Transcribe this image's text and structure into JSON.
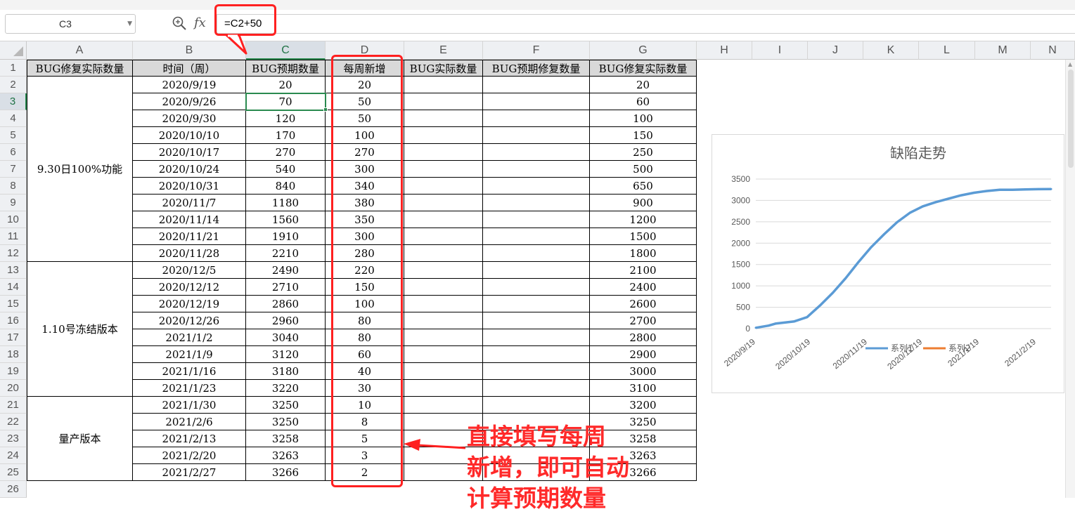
{
  "formula_bar": {
    "name_box": "C3",
    "formula": "=C2+50",
    "zoom_icon": "zoom-formula-icon",
    "fx_icon": "fx-function-icon"
  },
  "columns": [
    "A",
    "B",
    "C",
    "D",
    "E",
    "F",
    "G",
    "H",
    "I",
    "J",
    "K",
    "L",
    "M",
    "N"
  ],
  "row_numbers": [
    "1",
    "2",
    "3",
    "4",
    "5",
    "6",
    "7",
    "8",
    "9",
    "10",
    "11",
    "12",
    "13",
    "14",
    "15",
    "16",
    "17",
    "18",
    "19",
    "20",
    "21",
    "22",
    "23",
    "24",
    "25",
    "26"
  ],
  "selected_cell": {
    "column": "C",
    "row": "3"
  },
  "headers": [
    "BUG修复实际数量",
    "时间（周）",
    "BUG预期数量",
    "每周新增",
    "BUG实际数量",
    "BUG预期修复数量",
    "BUG修复实际数量"
  ],
  "groups": [
    "9.30日100%功能",
    "1.10号冻结版本",
    "量产版本"
  ],
  "rows": [
    {
      "date": "2020/9/19",
      "expected": "20",
      "weekly": "20",
      "fix_actual": "20"
    },
    {
      "date": "2020/9/26",
      "expected": "70",
      "weekly": "50",
      "fix_actual": "60"
    },
    {
      "date": "2020/9/30",
      "expected": "120",
      "weekly": "50",
      "fix_actual": "100"
    },
    {
      "date": "2020/10/10",
      "expected": "170",
      "weekly": "100",
      "fix_actual": "150"
    },
    {
      "date": "2020/10/17",
      "expected": "270",
      "weekly": "270",
      "fix_actual": "250"
    },
    {
      "date": "2020/10/24",
      "expected": "540",
      "weekly": "300",
      "fix_actual": "500"
    },
    {
      "date": "2020/10/31",
      "expected": "840",
      "weekly": "340",
      "fix_actual": "650"
    },
    {
      "date": "2020/11/7",
      "expected": "1180",
      "weekly": "380",
      "fix_actual": "900"
    },
    {
      "date": "2020/11/14",
      "expected": "1560",
      "weekly": "350",
      "fix_actual": "1200"
    },
    {
      "date": "2020/11/21",
      "expected": "1910",
      "weekly": "300",
      "fix_actual": "1500"
    },
    {
      "date": "2020/11/28",
      "expected": "2210",
      "weekly": "280",
      "fix_actual": "1800"
    },
    {
      "date": "2020/12/5",
      "expected": "2490",
      "weekly": "220",
      "fix_actual": "2100"
    },
    {
      "date": "2020/12/12",
      "expected": "2710",
      "weekly": "150",
      "fix_actual": "2400"
    },
    {
      "date": "2020/12/19",
      "expected": "2860",
      "weekly": "100",
      "fix_actual": "2600"
    },
    {
      "date": "2020/12/26",
      "expected": "2960",
      "weekly": "80",
      "fix_actual": "2700"
    },
    {
      "date": "2021/1/2",
      "expected": "3040",
      "weekly": "80",
      "fix_actual": "2800"
    },
    {
      "date": "2021/1/9",
      "expected": "3120",
      "weekly": "60",
      "fix_actual": "2900"
    },
    {
      "date": "2021/1/16",
      "expected": "3180",
      "weekly": "40",
      "fix_actual": "3000"
    },
    {
      "date": "2021/1/23",
      "expected": "3220",
      "weekly": "30",
      "fix_actual": "3100"
    },
    {
      "date": "2021/1/30",
      "expected": "3250",
      "weekly": "10",
      "fix_actual": "3200"
    },
    {
      "date": "2021/2/6",
      "expected": "3250",
      "weekly": "8",
      "fix_actual": "3250"
    },
    {
      "date": "2021/2/13",
      "expected": "3258",
      "weekly": "5",
      "fix_actual": "3258"
    },
    {
      "date": "2021/2/20",
      "expected": "3263",
      "weekly": "3",
      "fix_actual": "3263"
    },
    {
      "date": "2021/2/27",
      "expected": "3266",
      "weekly": "2",
      "fix_actual": "3266"
    }
  ],
  "annotation": [
    "直接填写每周",
    "新增，即可自动",
    "计算预期数量"
  ],
  "colors": {
    "accent_green": "#217346",
    "red": "#ff2020",
    "series1": "#5b9bd5",
    "series2": "#ed7d31"
  },
  "chart_data": {
    "type": "line",
    "title": "缺陷走势",
    "x": [
      "2020/9/19",
      "2020/9/26",
      "2020/9/30",
      "2020/10/10",
      "2020/10/17",
      "2020/10/24",
      "2020/10/31",
      "2020/11/7",
      "2020/11/14",
      "2020/11/21",
      "2020/11/28",
      "2020/12/5",
      "2020/12/12",
      "2020/12/19",
      "2020/12/26",
      "2021/1/2",
      "2021/1/9",
      "2021/1/16",
      "2021/1/23",
      "2021/1/30",
      "2021/2/6",
      "2021/2/13",
      "2021/2/20",
      "2021/2/27"
    ],
    "x_tick_labels": [
      "2020/9/19",
      "2020/10/19",
      "2020/11/19",
      "2020/12/19",
      "2021/1/19",
      "2021/2/19"
    ],
    "series": [
      {
        "name": "系列1",
        "values": [
          20,
          70,
          120,
          170,
          270,
          540,
          840,
          1180,
          1560,
          1910,
          2210,
          2490,
          2710,
          2860,
          2960,
          3040,
          3120,
          3180,
          3220,
          3250,
          3250,
          3258,
          3263,
          3266
        ]
      },
      {
        "name": "系列2",
        "values": []
      }
    ],
    "yticks": [
      "0",
      "500",
      "1000",
      "1500",
      "2000",
      "2500",
      "3000",
      "3500"
    ],
    "ylim": [
      0,
      3500
    ],
    "grid": true,
    "legend_position": "bottom"
  }
}
